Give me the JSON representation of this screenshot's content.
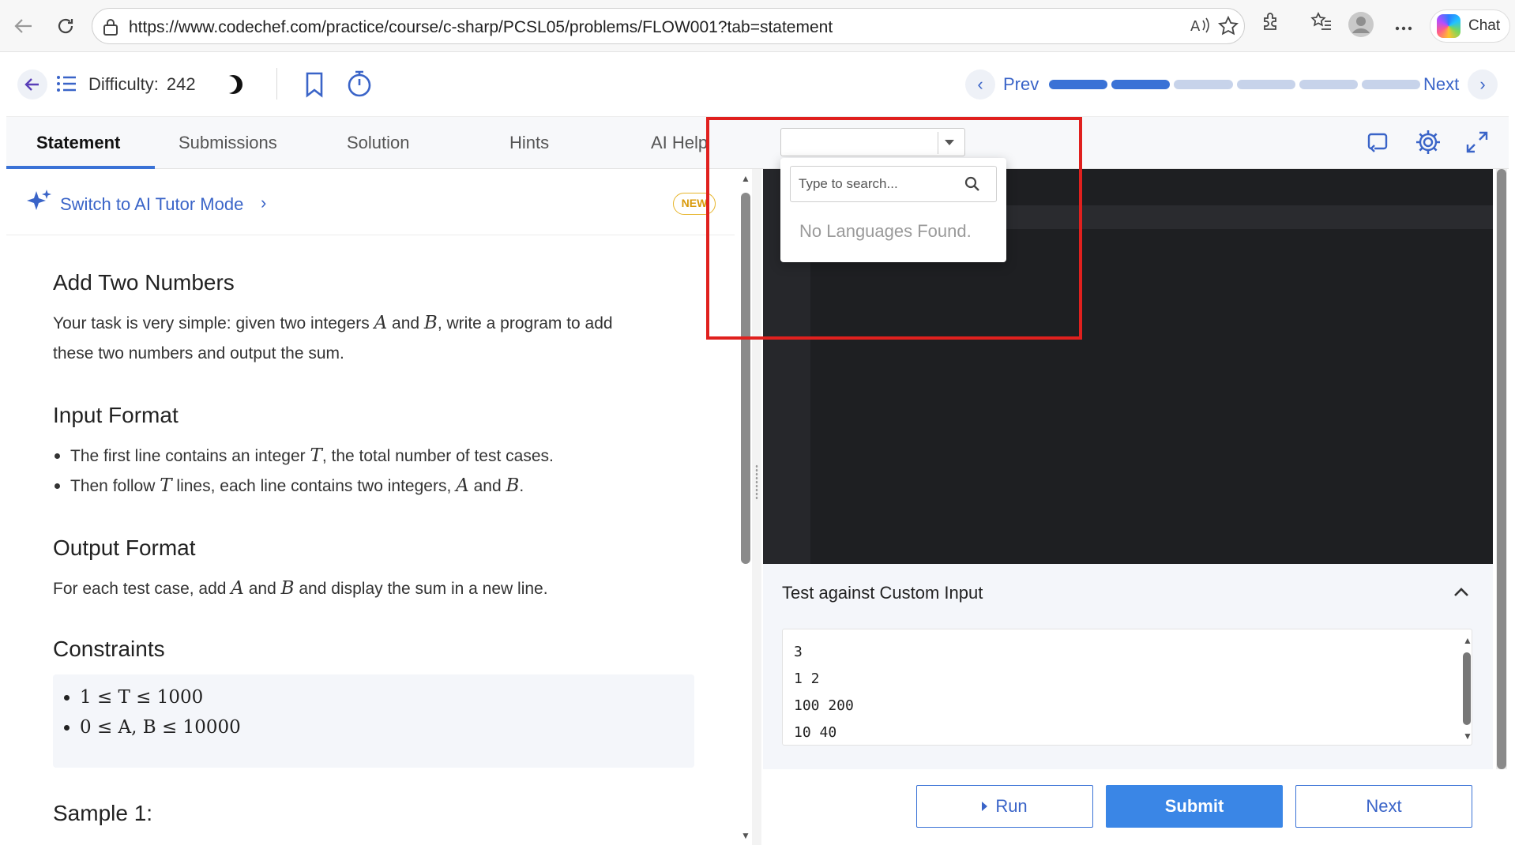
{
  "browser": {
    "url": "https://www.codechef.com/practice/course/c-sharp/PCSL05/problems/FLOW001?tab=statement",
    "chat_label": "Chat"
  },
  "header": {
    "difficulty_label": "Difficulty:",
    "difficulty_value": "242",
    "prev_label": "Prev",
    "next_label": "Next",
    "progress": {
      "total_segments": 6,
      "completed_segments": 2
    }
  },
  "tabs": [
    {
      "label": "Statement",
      "active": true
    },
    {
      "label": "Submissions",
      "active": false
    },
    {
      "label": "Solution",
      "active": false
    },
    {
      "label": "Hints",
      "active": false
    },
    {
      "label": "AI Help",
      "active": false
    }
  ],
  "ai_tutor": {
    "link": "Switch to AI Tutor Mode",
    "badge": "NEW"
  },
  "problem": {
    "title": "Add Two Numbers",
    "description_parts": [
      "Your task is very simple: given two integers ",
      "A",
      " and ",
      "B",
      ", write a program to add",
      "these two numbers and output the sum."
    ],
    "input_heading": "Input Format",
    "input_lines": [
      [
        "The first line contains an integer ",
        "T",
        ", the total number of test cases."
      ],
      [
        "Then follow ",
        "T",
        " lines, each line contains two integers, ",
        "A",
        " and ",
        "B",
        "."
      ]
    ],
    "output_heading": "Output Format",
    "output_parts": [
      "For each test case, add ",
      "A",
      " and ",
      "B",
      " and display the sum in a new line."
    ],
    "constraints_heading": "Constraints",
    "constraints": [
      "1 ≤ T ≤ 1000",
      "0 ≤ A, B ≤ 10000"
    ],
    "sample_heading": "Sample 1:"
  },
  "language_dropdown": {
    "search_placeholder": "Type to search...",
    "empty_message": "No Languages Found."
  },
  "custom_input": {
    "title": "Test against Custom Input",
    "value": "3\n1 2\n100 200\n10 40"
  },
  "actions": {
    "run": "Run",
    "submit": "Submit",
    "next": "Next"
  },
  "colors": {
    "accent": "#3a72d6",
    "highlight": "#e0201e",
    "editor_bg": "#1e1f22"
  }
}
